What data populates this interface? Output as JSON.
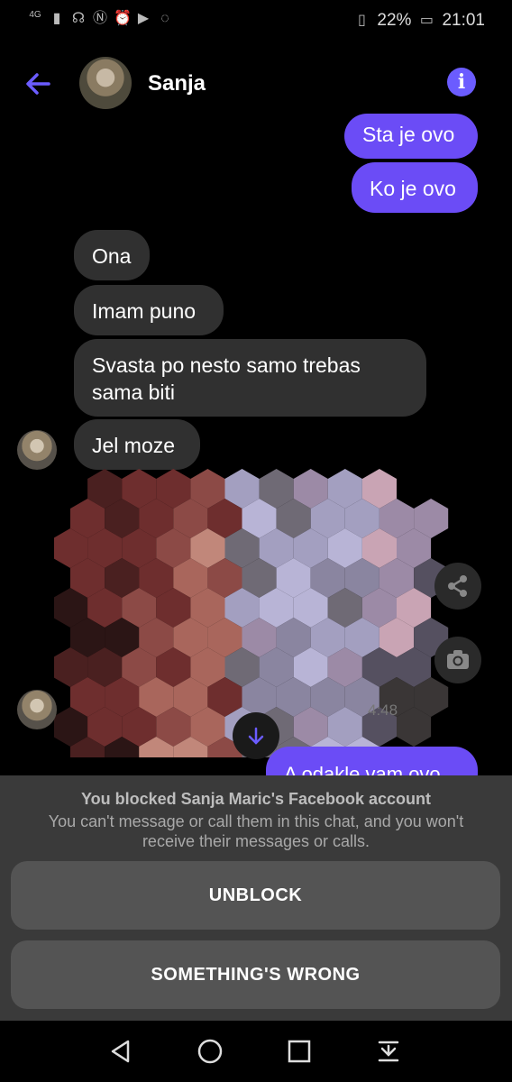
{
  "status_bar": {
    "left_icons": [
      "network-4g-icon",
      "signal-icon",
      "headphones-icon",
      "nfc-icon",
      "alarm-icon",
      "youtube-icon",
      "messenger-icon"
    ],
    "network_label": "4G",
    "battery_percent": "22%",
    "time": "21:01"
  },
  "header": {
    "contact_name": "Sanja",
    "info_icon": "i"
  },
  "messages": [
    {
      "direction": "out",
      "text": "Sta je ovo"
    },
    {
      "direction": "out",
      "text": "Ko je ovo"
    },
    {
      "direction": "in",
      "text": "Ona"
    },
    {
      "direction": "in",
      "text": "Imam puno"
    },
    {
      "direction": "in",
      "text": "Svasta po nesto samo trebas sama biti"
    },
    {
      "direction": "in",
      "text": "Jel moze"
    },
    {
      "direction": "out",
      "text": "A odakle vam ovo"
    }
  ],
  "image_message": {
    "time": "4:48"
  },
  "blocked": {
    "title": "You blocked Sanja Maric's Facebook account",
    "description": "You can't message or call them in this chat, and you won't receive their messages or calls.",
    "unblock_label": "UNBLOCK",
    "wrong_label": "SOMETHING'S WRONG"
  },
  "colors": {
    "accent": "#6b4cf6",
    "incoming_bubble": "#303030",
    "panel": "#3a3a3a",
    "button": "#545454"
  }
}
